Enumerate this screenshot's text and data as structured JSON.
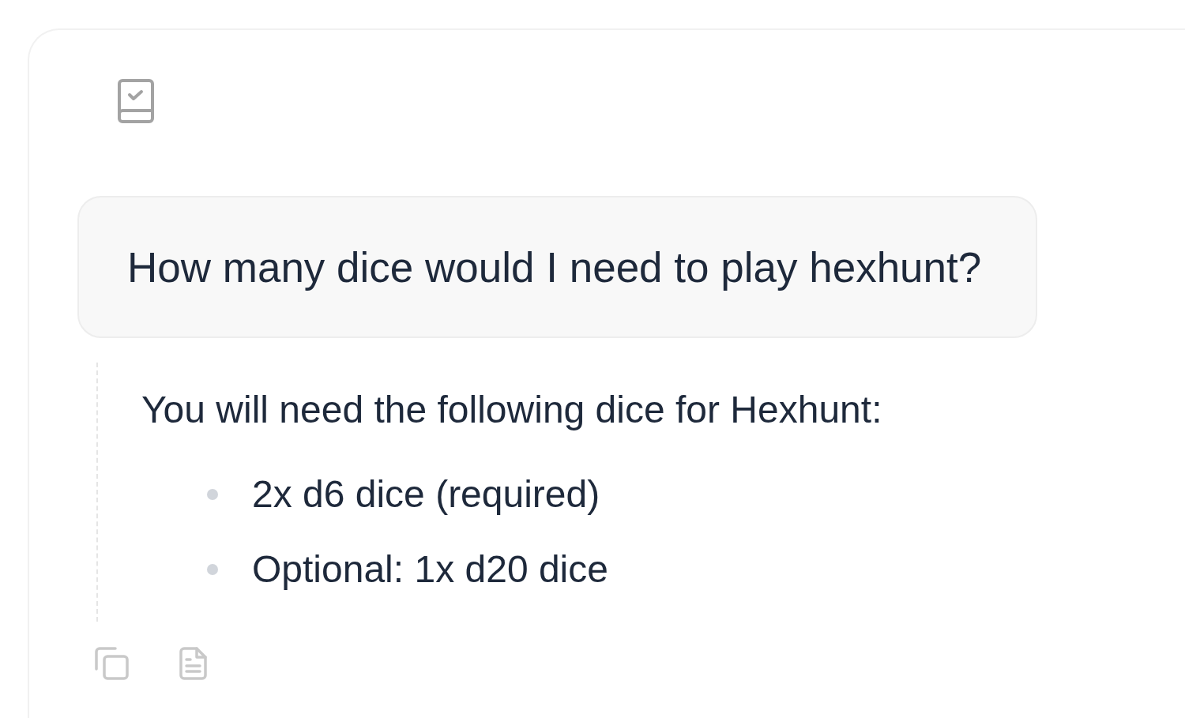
{
  "question": {
    "text": "How many dice would I need to play hexhunt?"
  },
  "answer": {
    "intro": "You will need the following dice for Hexhunt:",
    "items": [
      "2x d6 dice (required)",
      "Optional: 1x d20 dice"
    ]
  }
}
